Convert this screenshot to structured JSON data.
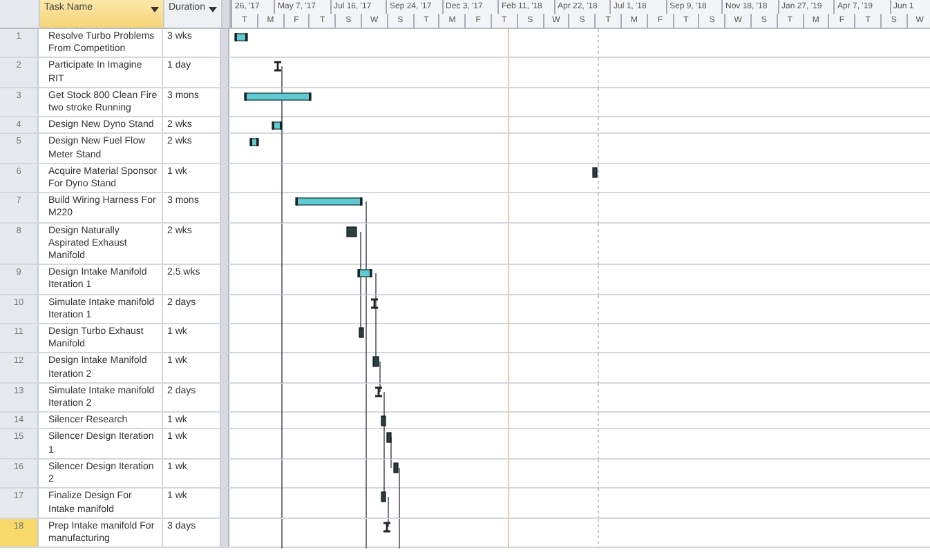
{
  "columns": [
    {
      "label": "Task Name",
      "highlighted": true
    },
    {
      "label": "Duration",
      "highlighted": false
    }
  ],
  "timescale": {
    "top": [
      "26, '17",
      "May 7, '17",
      "Jul 16, '17",
      "Sep 24, '17",
      "Dec 3, '17",
      "Feb 11, '18",
      "Apr 22, '18",
      "Jul 1, '18",
      "Sep 9, '18",
      "Nov 18, '18",
      "Jan 27, '19",
      "Apr 7, '19",
      "Jun 1"
    ],
    "bottom": [
      "T",
      "M",
      "F",
      "T",
      "S",
      "W",
      "S",
      "T",
      "M",
      "F",
      "T",
      "S",
      "W",
      "S",
      "T",
      "M",
      "F",
      "T",
      "S",
      "W",
      "S",
      "T",
      "M",
      "F",
      "T",
      "S",
      "W"
    ]
  },
  "rows": [
    {
      "id": "1",
      "name": "Resolve Turbo Problems From Competition",
      "duration": "3 wks",
      "selected": false
    },
    {
      "id": "2",
      "name": "Participate In Imagine RIT",
      "duration": "1 day",
      "selected": false
    },
    {
      "id": "3",
      "name": "Get Stock 800 Clean Fire two stroke Running",
      "duration": "3 mons",
      "selected": false
    },
    {
      "id": "4",
      "name": "Design New Dyno Stand",
      "duration": "2 wks",
      "selected": false
    },
    {
      "id": "5",
      "name": "Design New Fuel Flow Meter Stand",
      "duration": "2 wks",
      "selected": false
    },
    {
      "id": "6",
      "name": "Acquire Material Sponsor For Dyno Stand",
      "duration": "1 wk",
      "selected": false
    },
    {
      "id": "7",
      "name": "Build Wiring Harness For M220",
      "duration": "3 mons",
      "selected": false
    },
    {
      "id": "8",
      "name": "Design Naturally Aspirated Exhaust Manifold",
      "duration": "2 wks",
      "selected": false
    },
    {
      "id": "9",
      "name": "Design Intake Manifold Iteration 1",
      "duration": "2.5 wks",
      "selected": false
    },
    {
      "id": "10",
      "name": "Simulate Intake manifold Iteration 1",
      "duration": "2 days",
      "selected": false
    },
    {
      "id": "11",
      "name": "Design Turbo Exhaust Manifold",
      "duration": "1 wk",
      "selected": false
    },
    {
      "id": "12",
      "name": "Design Intake Manifold Iteration 2",
      "duration": "1 wk",
      "selected": false
    },
    {
      "id": "13",
      "name": "Simulate Intake manifold Iteration 2",
      "duration": "2 days",
      "selected": false
    },
    {
      "id": "14",
      "name": "Silencer Research",
      "duration": "1 wk",
      "selected": false
    },
    {
      "id": "15",
      "name": "Silencer Design Iteration 1",
      "duration": "1 wk",
      "selected": false
    },
    {
      "id": "16",
      "name": "Silencer Design Iteration 2",
      "duration": "1 wk",
      "selected": false
    },
    {
      "id": "17",
      "name": "Finalize Design For Intake manifold",
      "duration": "1 wk",
      "selected": false
    },
    {
      "id": "18",
      "name": "Prep Intake manifold For manufacturing",
      "duration": "3 days",
      "selected": true
    }
  ]
}
